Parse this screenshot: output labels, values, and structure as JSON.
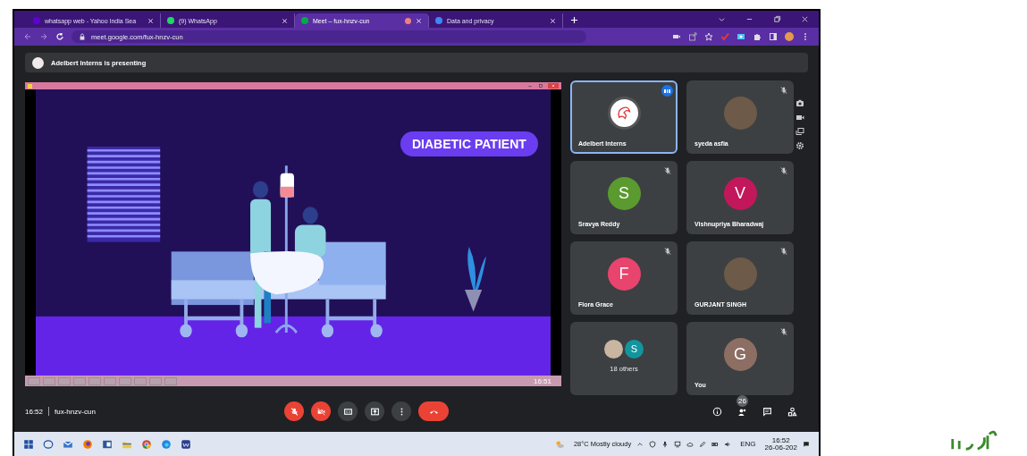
{
  "browser": {
    "tabs": [
      {
        "title": "whatsapp web - Yahoo India Sea",
        "selected": false,
        "color": "#6001d2",
        "recording": false
      },
      {
        "title": "(9) WhatsApp",
        "selected": false,
        "color": "#25d366",
        "recording": false
      },
      {
        "title": "Meet – fux-hnzv-cun",
        "selected": true,
        "color": "#00ac47",
        "recording": true
      },
      {
        "title": "Data and privacy",
        "selected": false,
        "color": "#4285f4",
        "recording": false
      }
    ],
    "url": "meet.google.com/fux-hnzv-cun"
  },
  "presenting_banner": "Adelbert Interns is presenting",
  "slide": {
    "heading": "DIABETIC PATIENT",
    "clock": "16:51"
  },
  "tiles": [
    {
      "kind": "logo",
      "name": "Adelbert Interns",
      "speaking": true,
      "muted": false
    },
    {
      "kind": "photo",
      "name": "syeda asfia",
      "speaking": false,
      "muted": true
    },
    {
      "kind": "letter",
      "name": "Sravya Reddy",
      "initial": "S",
      "color": "#5b9a2f",
      "speaking": false,
      "muted": true
    },
    {
      "kind": "letter",
      "name": "Vishnupriya Bharadwaj",
      "initial": "V",
      "color": "#c2185b",
      "speaking": false,
      "muted": true
    },
    {
      "kind": "letter",
      "name": "Flora Grace",
      "initial": "F",
      "color": "#e8446e",
      "speaking": false,
      "muted": true
    },
    {
      "kind": "photo",
      "name": "GURJANT SINGH",
      "speaking": false,
      "muted": true
    },
    {
      "kind": "others",
      "name": "18 others",
      "initial": "S",
      "color": "#12959e",
      "speaking": false,
      "muted": false
    },
    {
      "kind": "letter",
      "name": "You",
      "initial": "G",
      "color": "#8d6e63",
      "speaking": false,
      "muted": true
    }
  ],
  "meeting": {
    "time": "16:52",
    "code": "fux-hnzv-cun",
    "people_count": "26"
  },
  "controls": [
    {
      "kind": "mic-off"
    },
    {
      "kind": "camera-off"
    },
    {
      "kind": "captions"
    },
    {
      "kind": "present"
    },
    {
      "kind": "more"
    },
    {
      "kind": "hang-up"
    }
  ],
  "taskbar": {
    "weather": "28°C Mostly cloudy",
    "language": "ENG",
    "time": "16:52",
    "date": "26-06-202"
  }
}
